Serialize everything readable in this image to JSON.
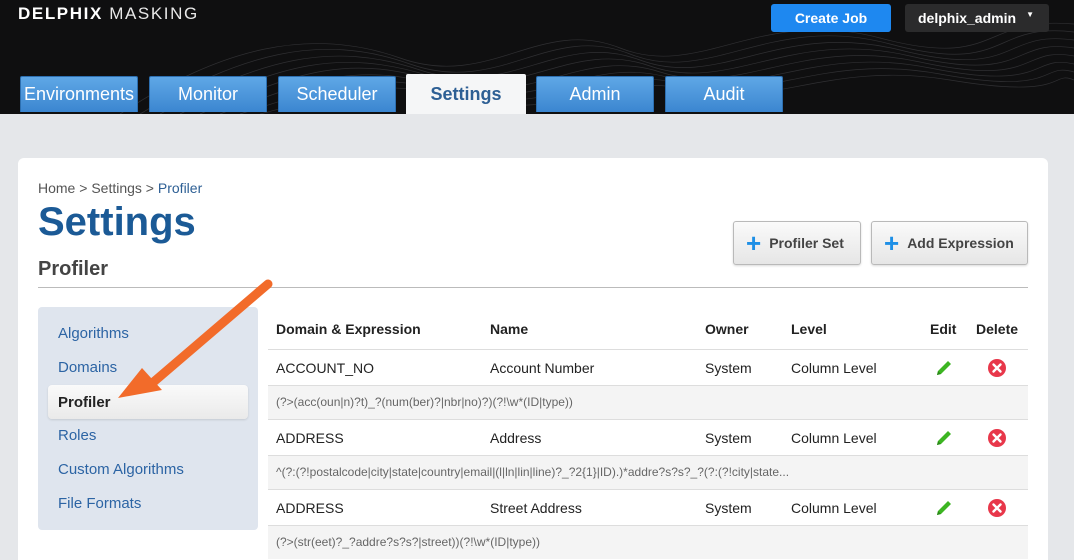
{
  "brand": {
    "bold": "DELPHIX",
    "light": "MASKING"
  },
  "header": {
    "create_job": "Create Job",
    "user": "delphix_admin"
  },
  "tabs": [
    "Environments",
    "Monitor",
    "Scheduler",
    "Settings",
    "Admin",
    "Audit"
  ],
  "active_tab": "Settings",
  "breadcrumb": {
    "home": "Home",
    "sep1": " > ",
    "settings": "Settings",
    "sep2": " > ",
    "current": "Profiler"
  },
  "page": {
    "title": "Settings",
    "section": "Profiler"
  },
  "actions": {
    "profiler_set": "Profiler Set",
    "add_expression": "Add Expression"
  },
  "sidebar": {
    "items": [
      "Algorithms",
      "Domains",
      "Profiler",
      "Roles",
      "Custom Algorithms",
      "File Formats"
    ],
    "active": "Profiler"
  },
  "table": {
    "headers": [
      "Domain & Expression",
      "Name",
      "Owner",
      "Level",
      "Edit",
      "Delete"
    ],
    "rows": [
      {
        "domain": "ACCOUNT_NO",
        "name": "Account Number",
        "owner": "System",
        "level": "Column Level",
        "expression": "(?>(acc(oun|n)?t)_?(num(ber)?|nbr|no)?)(?!\\w*(ID|type))"
      },
      {
        "domain": "ADDRESS",
        "name": "Address",
        "owner": "System",
        "level": "Column Level",
        "expression": "^(?:(?!postalcode|city|state|country|email|(l|ln|lin|line)?_?2{1}|ID).)*addre?s?s?_?(?:(?!city|state..."
      },
      {
        "domain": "ADDRESS",
        "name": "Street Address",
        "owner": "System",
        "level": "Column Level",
        "expression": "(?>(str(eet)?_?addre?s?s?|street))(?!\\w*(ID|type))"
      }
    ]
  },
  "colors": {
    "tab_blue": "#4a96dc",
    "title_blue": "#1b5a96",
    "link_blue": "#2c64a4",
    "create_job_blue": "#1e88f0",
    "edit_green": "#3cb521",
    "delete_red": "#e8374a",
    "arrow_orange": "#f26b2a"
  },
  "icons": {
    "edit": "pencil-icon",
    "delete": "circle-x-icon",
    "add": "plus-icon",
    "user_menu": "caret-down-icon"
  }
}
